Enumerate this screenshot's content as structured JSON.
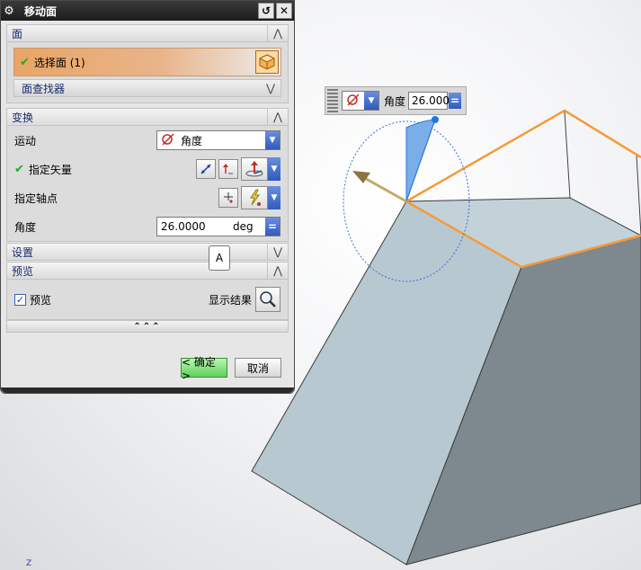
{
  "dialog": {
    "title": "移动面",
    "sections": {
      "face": {
        "header": "面",
        "select_face_label": "选择面 (1)",
        "face_finder_label": "面查找器"
      },
      "transform": {
        "header": "变换",
        "motion_label": "运动",
        "motion_value": "角度",
        "vector_label": "指定矢量",
        "pivot_label": "指定轴点",
        "angle_label": "角度",
        "angle_value": "26.0000",
        "angle_unit": "deg"
      },
      "settings": {
        "header": "设置"
      },
      "preview": {
        "header": "预览",
        "preview_checkbox_label": "预览",
        "preview_checked": true,
        "show_result_label": "显示结果"
      }
    },
    "tooltip": "A",
    "more_glyph": "⌃⌃⌃",
    "ok_label": "< 确定 >",
    "cancel_label": "取消"
  },
  "floating_toolbar": {
    "angle_label": "角度",
    "angle_value": "26.000"
  },
  "viewport": {
    "axis_label": "Z",
    "colors": {
      "model_face": "#b9c9d1",
      "model_side": "#7d8a8f",
      "selected_edge": "#f59a3a",
      "rotation_handle": "#2a72d8"
    }
  }
}
